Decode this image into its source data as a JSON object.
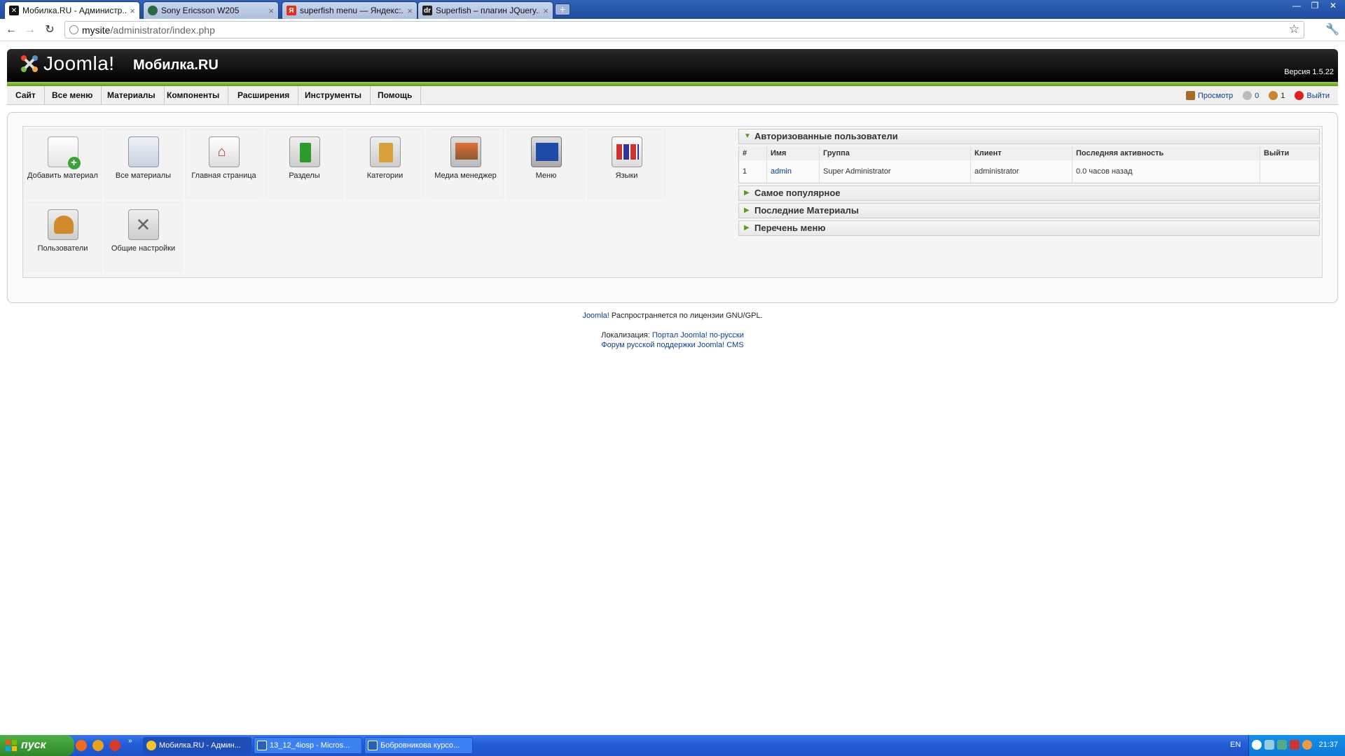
{
  "browser": {
    "tabs": [
      {
        "label": "Мобилка.RU - Администр...",
        "active": true
      },
      {
        "label": "Sony Ericsson W205",
        "active": false
      },
      {
        "label": "superfish menu — Яндекс:...",
        "active": false
      },
      {
        "label": "Superfish – плагин JQuery...",
        "active": false
      }
    ],
    "url_host": "mysite",
    "url_path": "/administrator/index.php"
  },
  "header": {
    "logo_text": "Joomla!",
    "site_name": "Мобилка.RU",
    "version": "Версия 1.5.22"
  },
  "menu": [
    "Сайт",
    "Все меню",
    "Материалы",
    "Компоненты",
    "Расширения",
    "Инструменты",
    "Помощь"
  ],
  "status": {
    "preview": "Просмотр",
    "messages": "0",
    "users": "1",
    "logout": "Выйти"
  },
  "cpanel": [
    {
      "label": "Добавить материал",
      "icon": "add-article-icon"
    },
    {
      "label": "Все материалы",
      "icon": "articles-icon"
    },
    {
      "label": "Главная страница",
      "icon": "frontpage-icon"
    },
    {
      "label": "Разделы",
      "icon": "sections-icon"
    },
    {
      "label": "Категории",
      "icon": "categories-icon"
    },
    {
      "label": "Медиа менеджер",
      "icon": "media-icon"
    },
    {
      "label": "Меню",
      "icon": "menu-icon"
    },
    {
      "label": "Языки",
      "icon": "languages-icon"
    },
    {
      "label": "Пользователи",
      "icon": "users-icon"
    },
    {
      "label": "Общие настройки",
      "icon": "config-icon"
    }
  ],
  "panels": {
    "logged_users": {
      "title": "Авторизованные пользователи",
      "headers": [
        "#",
        "Имя",
        "Группа",
        "Клиент",
        "Последняя активность",
        "Выйти"
      ],
      "rows": [
        [
          "1",
          "admin",
          "Super Administrator",
          "administrator",
          "0.0 часов назад",
          ""
        ]
      ]
    },
    "collapsed": [
      "Самое популярное",
      "Последние Материалы",
      "Перечень меню"
    ]
  },
  "footer": {
    "joomla": "Joomla!",
    "license": " Распространяется по лицензии GNU/GPL.",
    "localization": "Локализация: ",
    "portal": "Портал Joomla! по-русски",
    "forum": "Форум русской поддержки Joomla! CMS"
  },
  "taskbar": {
    "start": "пуск",
    "windows": [
      {
        "label": "Мобилка.RU - Админ...",
        "active": true
      },
      {
        "label": "13_12_4iosp - Micros...",
        "active": false
      },
      {
        "label": "Бобровникова курсо...",
        "active": false
      }
    ],
    "lang": "EN",
    "time": "21:37"
  },
  "colors": {
    "joomla_green": "#6cb22a",
    "link_blue": "#0b3f8c",
    "xp_blue": "#245edb"
  }
}
